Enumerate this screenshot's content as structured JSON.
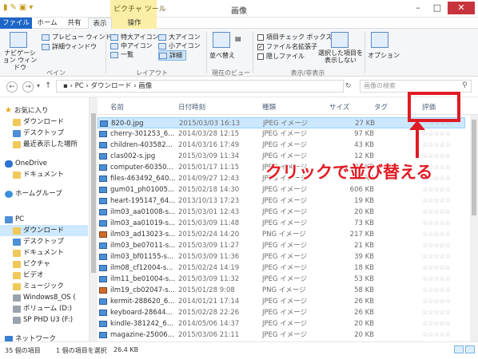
{
  "window": {
    "title": "画像",
    "context_tab_label": "ピクチャ ツール",
    "minimize_icon": "minimize-icon",
    "maximize_icon": "maximize-icon",
    "close_icon": "close-icon"
  },
  "tabs": {
    "file": "ファイル",
    "home": "ホーム",
    "share": "共有",
    "view": "表示",
    "manage": "操作"
  },
  "ribbon": {
    "pane_group": "ペイン",
    "layout_group": "レイアウト",
    "current_view_group": "現在のビュー",
    "show_hide_group": "表示/非表示",
    "nav_pane": "ナビゲーション ウィンドウ",
    "preview_pane": "プレビュー ウィンドウ",
    "details_pane": "詳細ウィンドウ",
    "xl_icons": "特大アイコン",
    "large_icons": "大アイコン",
    "medium_icons": "中アイコン",
    "small_icons": "小アイコン",
    "list": "一覧",
    "details": "詳細",
    "sort_by": "並べ替え",
    "item_checkboxes": "項目チェック ボックス",
    "file_extensions": "ファイル名拡張子",
    "hidden_items": "隠しファイル",
    "hide_selected": "選択した項目を表示しない",
    "options": "オプション"
  },
  "address": {
    "path": [
      "PC",
      "ダウンロード",
      "画像"
    ],
    "search_placeholder": "画像の検索"
  },
  "nav": {
    "favorites": "お気に入り",
    "downloads": "ダウンロード",
    "desktop": "デスクトップ",
    "recent": "最近表示した場所",
    "onedrive": "OneDrive",
    "documents": "ドキュメント",
    "homegroup": "ホームグループ",
    "pc": "PC",
    "pc_downloads": "ダウンロード",
    "pc_desktop": "デスクトップ",
    "pc_documents": "ドキュメント",
    "pictures": "ピクチャ",
    "videos": "ビデオ",
    "music": "ミュージック",
    "windows8": "Windows8_OS (",
    "volume_d": "ボリューム (D:)",
    "sp_phd": "SP PHD U3 (F:)",
    "network": "ネットワーク"
  },
  "columns": {
    "name": "名前",
    "date": "日付時刻",
    "type": "種類",
    "size": "サイズ",
    "tags": "タグ",
    "rating": "評価"
  },
  "files": [
    {
      "name": "820-0.jpg",
      "date": "2015/03/03 16:13",
      "type": "JPEG イメージ",
      "size": "27 KB",
      "png": false,
      "rating": "☆☆☆☆☆"
    },
    {
      "name": "cherry-301253_6...",
      "date": "2014/03/28 12:15",
      "type": "JPEG イメージ",
      "size": "97 KB",
      "png": false,
      "rating": "☆☆☆☆☆"
    },
    {
      "name": "children-403582...",
      "date": "2014/03/16 17:49",
      "type": "JPEG イメージ",
      "size": "43 KB",
      "png": false,
      "rating": "☆☆☆☆☆"
    },
    {
      "name": "clas002-s.jpg",
      "date": "2015/03/09 11:34",
      "type": "JPEG イメージ",
      "size": "12 KB",
      "png": false,
      "rating": "☆☆☆☆☆"
    },
    {
      "name": "computer-60350...",
      "date": "2015/01/17 11:15",
      "type": "JPEG イメージ",
      "size": "31 KB",
      "png": false,
      "rating": "☆☆☆☆☆"
    },
    {
      "name": "files-463492_640...",
      "date": "2014/09/27 12:43",
      "type": "JPEG イメージ",
      "size": "27 KB",
      "png": false,
      "rating": "☆☆☆☆☆"
    },
    {
      "name": "gum01_ph01005...",
      "date": "2015/02/18 14:30",
      "type": "JPEG イメージ",
      "size": "606 KB",
      "png": false,
      "rating": "☆☆☆☆☆"
    },
    {
      "name": "heart-195147_64...",
      "date": "2013/10/13 17:23",
      "type": "JPEG イメージ",
      "size": "19 KB",
      "png": false,
      "rating": "☆☆☆☆☆"
    },
    {
      "name": "ilm03_aa01008-s...",
      "date": "2015/03/01 12:43",
      "type": "JPEG イメージ",
      "size": "20 KB",
      "png": false,
      "rating": "☆☆☆☆☆"
    },
    {
      "name": "ilm03_aa01019-s...",
      "date": "2015/03/09 11:48",
      "type": "JPEG イメージ",
      "size": "73 KB",
      "png": false,
      "rating": "☆☆☆☆☆"
    },
    {
      "name": "ilm03_ad13023-s...",
      "date": "2015/02/24 14:20",
      "type": "PNG イメージ",
      "size": "217 KB",
      "png": true,
      "rating": "☆☆☆☆☆"
    },
    {
      "name": "ilm03_be07011-s...",
      "date": "2015/03/09 11:27",
      "type": "JPEG イメージ",
      "size": "21 KB",
      "png": false,
      "rating": "☆☆☆☆☆"
    },
    {
      "name": "ilm03_bf01155-s...",
      "date": "2015/03/09 11:36",
      "type": "JPEG イメージ",
      "size": "39 KB",
      "png": false,
      "rating": "☆☆☆☆☆"
    },
    {
      "name": "ilm08_cf12004-s...",
      "date": "2015/02/24 14:19",
      "type": "JPEG イメージ",
      "size": "18 KB",
      "png": false,
      "rating": "☆☆☆☆☆"
    },
    {
      "name": "ilm11_be01004-s...",
      "date": "2015/03/09 11:32",
      "type": "JPEG イメージ",
      "size": "53 KB",
      "png": false,
      "rating": "☆☆☆☆☆"
    },
    {
      "name": "ilm19_cb02047-s...",
      "date": "2015/01/28 9:08",
      "type": "PNG イメージ",
      "size": "58 KB",
      "png": true,
      "rating": "☆☆☆☆☆"
    },
    {
      "name": "kermit-288620_6...",
      "date": "2014/01/21 17:14",
      "type": "JPEG イメージ",
      "size": "26 KB",
      "png": false,
      "rating": "☆☆☆☆☆"
    },
    {
      "name": "keyboard-28644...",
      "date": "2015/02/28 22:26",
      "type": "JPEG イメージ",
      "size": "26 KB",
      "png": false,
      "rating": "☆☆☆☆☆"
    },
    {
      "name": "kindle-381242_6...",
      "date": "2014/05/06 14:37",
      "type": "JPEG イメージ",
      "size": "20 KB",
      "png": false,
      "rating": "☆☆☆☆☆"
    },
    {
      "name": "magazine-25006...",
      "date": "2015/03/06 21:11",
      "type": "JPEG イメージ",
      "size": "20 KB",
      "png": false,
      "rating": "☆☆☆☆☆"
    }
  ],
  "status": {
    "count": "35 個の項目",
    "selected": "1 個の項目を選択",
    "selected_size": "26.4 KB"
  },
  "annotation": {
    "text": "クリックで並び替える",
    "color": "#e01b24"
  },
  "colors": {
    "file_tab": "#1e66c7",
    "context_tab": "#fbeea6",
    "selection": "#cce8ff"
  }
}
